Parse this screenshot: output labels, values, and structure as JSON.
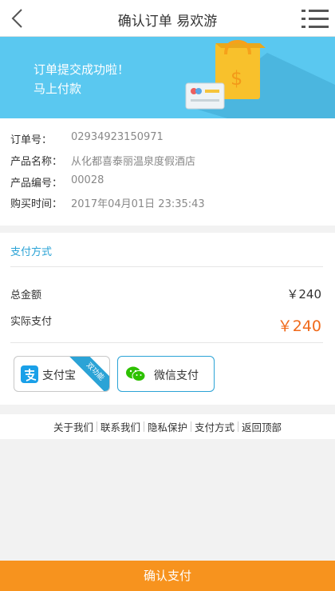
{
  "header": {
    "title": "确认订单 易欢游"
  },
  "banner": {
    "line1": "订单提交成功啦！",
    "line2": "马上付款"
  },
  "order": {
    "rows": [
      {
        "label": "订单号：",
        "value": "02934923150971"
      },
      {
        "label": "产品名称：",
        "value": "从化都喜泰丽温泉度假酒店"
      },
      {
        "label": "产品编号：",
        "value": "00028"
      },
      {
        "label": "购买时间：",
        "value": "2017年04月01日 23:35:43"
      }
    ]
  },
  "payment": {
    "method_title": "支付方式",
    "total_label": "总金额",
    "total_value": "￥240",
    "actual_label": "实际支付",
    "actual_value": "￥240",
    "alipay_label": "支付宝",
    "alipay_badge": "双功能",
    "wechat_label": "微信支付"
  },
  "footer": {
    "links": [
      "关于我们",
      "联系我们",
      "隐私保护",
      "支付方式",
      "返回顶部"
    ]
  },
  "confirm_button": "确认支付",
  "colors": {
    "accent": "#2ba3d6",
    "price": "#f06a1b",
    "confirm": "#f7931e",
    "banner": "#5ac8f0"
  }
}
